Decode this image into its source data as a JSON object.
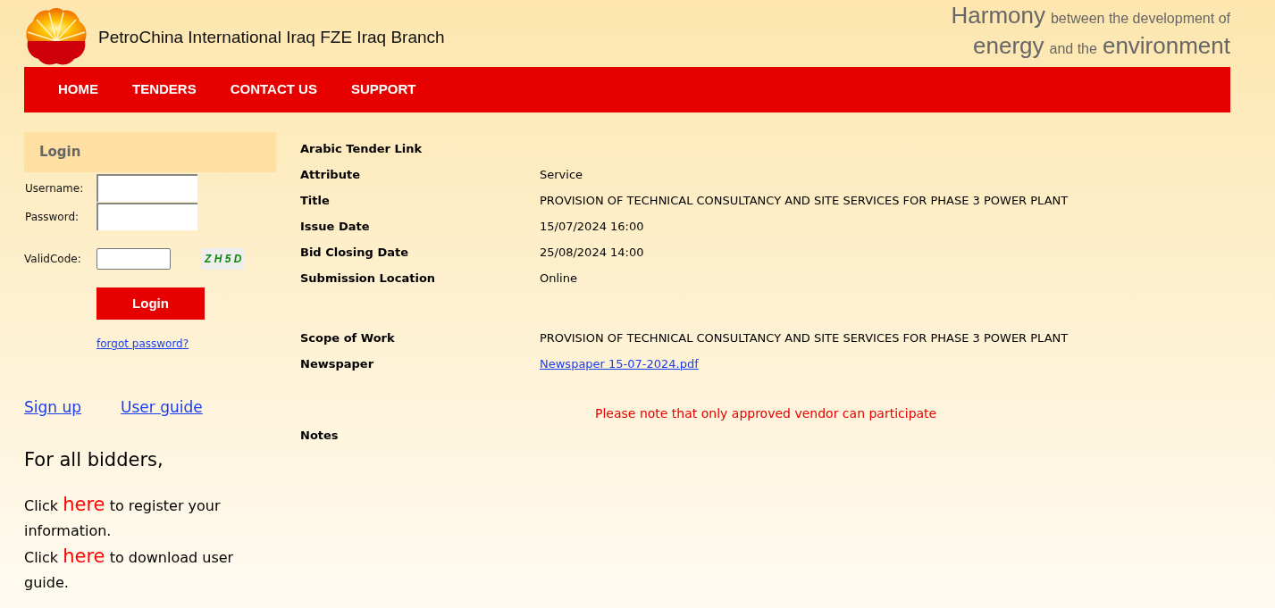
{
  "header": {
    "company": "PetroChina International Iraq FZE Iraq Branch",
    "slogan_lines": [
      [
        {
          "text": "Harmony",
          "emphasis": true
        },
        {
          "text": "between the development of",
          "emphasis": false
        }
      ],
      [
        {
          "text": "energy",
          "emphasis": true
        },
        {
          "text": "and the",
          "emphasis": false
        },
        {
          "text": "environment",
          "emphasis": true
        }
      ]
    ]
  },
  "nav": {
    "items": [
      "HOME",
      "TENDERS",
      "CONTACT US",
      "SUPPORT"
    ]
  },
  "login": {
    "title": "Login",
    "fields": [
      {
        "label": "Username:"
      },
      {
        "label": "Password:"
      }
    ],
    "valid_code_label": "ValidCode:",
    "captcha": "Z H 5 D",
    "button": "Login",
    "forgot": "forgot password?"
  },
  "links": [
    "Sign up",
    "User guide"
  ],
  "bidders": {
    "heading": "For all bidders,",
    "lines": [
      {
        "before": "Click",
        "link": "here",
        "after": "to register your information."
      },
      {
        "before": "Click",
        "link": "here",
        "after": "to download user guide."
      }
    ]
  },
  "details": [
    {
      "label": "Arabic Tender Link",
      "kind": "text"
    },
    {
      "label": "Attribute",
      "value": "Service",
      "kind": "text"
    },
    {
      "label": "Title",
      "value": "PROVISION OF TECHNICAL CONSULTANCY AND SITE SERVICES FOR PHASE 3 POWER PLANT",
      "kind": "text"
    },
    {
      "label": "Issue Date",
      "value": "15/07/2024 16:00",
      "kind": "text"
    },
    {
      "label": "Bid Closing Date",
      "value": "25/08/2024 14:00",
      "kind": "text"
    },
    {
      "label": "Submission Location",
      "value": "Online",
      "kind": "text"
    },
    {
      "kind": "spacer"
    },
    {
      "label": "Scope of Work",
      "value": "PROVISION OF TECHNICAL CONSULTANCY AND SITE SERVICES FOR PHASE 3 POWER PLANT",
      "kind": "text"
    },
    {
      "label": "Newspaper",
      "value": "Newspaper 15-07-2024.pdf",
      "kind": "link"
    }
  ],
  "notice": "Please note that only approved vendor can participate",
  "notes_label": "Notes"
}
